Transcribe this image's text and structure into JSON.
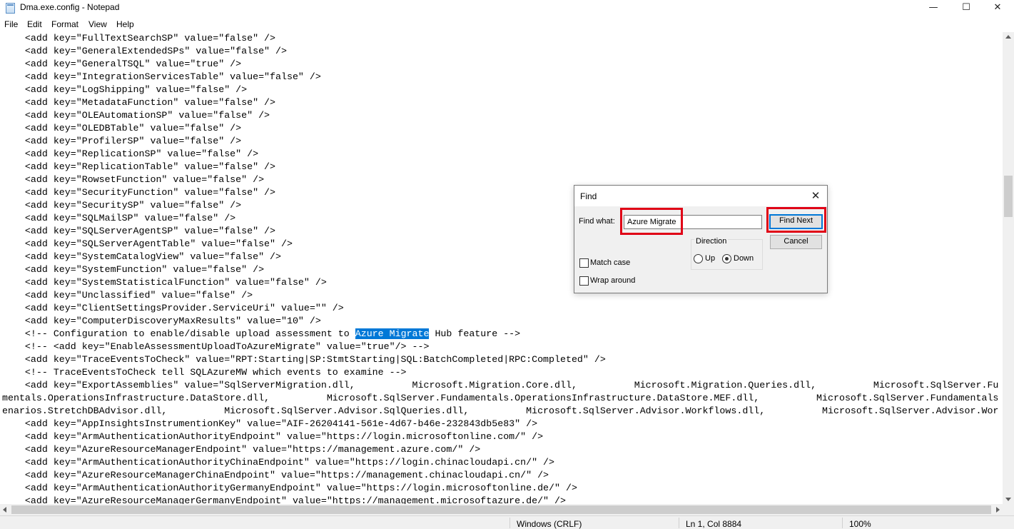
{
  "window": {
    "title": "Dma.exe.config - Notepad",
    "minimize_glyph": "—",
    "maximize_glyph": "☐",
    "close_glyph": "✕",
    "app_icon": "notepad-icon"
  },
  "menu": [
    "File",
    "Edit",
    "Format",
    "View",
    "Help"
  ],
  "editor": {
    "lines": [
      "    <add key=\"FullTextSearchSP\" value=\"false\" />",
      "    <add key=\"GeneralExtendedSPs\" value=\"false\" />",
      "    <add key=\"GeneralTSQL\" value=\"true\" />",
      "    <add key=\"IntegrationServicesTable\" value=\"false\" />",
      "    <add key=\"LogShipping\" value=\"false\" />",
      "    <add key=\"MetadataFunction\" value=\"false\" />",
      "    <add key=\"OLEAutomationSP\" value=\"false\" />",
      "    <add key=\"OLEDBTable\" value=\"false\" />",
      "    <add key=\"ProfilerSP\" value=\"false\" />",
      "    <add key=\"ReplicationSP\" value=\"false\" />",
      "    <add key=\"ReplicationTable\" value=\"false\" />",
      "    <add key=\"RowsetFunction\" value=\"false\" />",
      "    <add key=\"SecurityFunction\" value=\"false\" />",
      "    <add key=\"SecuritySP\" value=\"false\" />",
      "    <add key=\"SQLMailSP\" value=\"false\" />",
      "    <add key=\"SQLServerAgentSP\" value=\"false\" />",
      "    <add key=\"SQLServerAgentTable\" value=\"false\" />",
      "    <add key=\"SystemCatalogView\" value=\"false\" />",
      "    <add key=\"SystemFunction\" value=\"false\" />",
      "    <add key=\"SystemStatisticalFunction\" value=\"false\" />",
      "    <add key=\"Unclassified\" value=\"false\" />",
      "    <add key=\"ClientSettingsProvider.ServiceUri\" value=\"\" />",
      "    <add key=\"ComputerDiscoveryMaxResults\" value=\"10\" />"
    ],
    "highlight_line": {
      "before": "    <!-- Configuration to enable/disable upload assessment to ",
      "selected": "Azure Migrate",
      "after": " Hub feature -->"
    },
    "lines_after": [
      "    <!-- <add key=\"EnableAssessmentUploadToAzureMigrate\" value=\"true\"/> -->",
      "    <add key=\"TraceEventsToCheck\" value=\"RPT:Starting|SP:StmtStarting|SQL:BatchCompleted|RPC:Completed\" />",
      "    <!-- TraceEventsToCheck tell SQLAzureMW which events to examine -->",
      "    <add key=\"ExportAssemblies\" value=\"SqlServerMigration.dll,          Microsoft.Migration.Core.dll,          Microsoft.Migration.Queries.dll,          Microsoft.SqlServer.Fu",
      "mentals.OperationsInfrastructure.DataStore.dll,          Microsoft.SqlServer.Fundamentals.OperationsInfrastructure.DataStore.MEF.dll,          Microsoft.SqlServer.Fundamentals",
      "enarios.StretchDBAdvisor.dll,          Microsoft.SqlServer.Advisor.SqlQueries.dll,          Microsoft.SqlServer.Advisor.Workflows.dll,          Microsoft.SqlServer.Advisor.Wor",
      "    <add key=\"AppInsightsInstrumentionKey\" value=\"AIF-26204141-561e-4d67-b46e-232843db5e83\" />",
      "    <add key=\"ArmAuthenticationAuthorityEndpoint\" value=\"https://login.microsoftonline.com/\" />",
      "    <add key=\"AzureResourceManagerEndpoint\" value=\"https://management.azure.com/\" />",
      "    <add key=\"ArmAuthenticationAuthorityChinaEndpoint\" value=\"https://login.chinacloudapi.cn/\" />",
      "    <add key=\"AzureResourceManagerChinaEndpoint\" value=\"https://management.chinacloudapi.cn/\" />",
      "    <add key=\"ArmAuthenticationAuthorityGermanyEndpoint\" value=\"https://login.microsoftonline.de/\" />",
      "    <add key=\"AzureResourceManagerGermanyEndpoint\" value=\"https://management.microsoftazure.de/\" />"
    ]
  },
  "status": {
    "line_ending": "Windows (CRLF)",
    "position": "Ln 1, Col 8884",
    "zoom": "100%"
  },
  "find_dialog": {
    "title": "Find",
    "find_what_label": "Find what:",
    "find_what_value": "Azure Migrate",
    "find_next_label": "Find Next",
    "cancel_label": "Cancel",
    "direction_label": "Direction",
    "up_label": "Up",
    "down_label": "Down",
    "direction_selected": "Down",
    "match_case_label": "Match case",
    "match_case_checked": false,
    "wrap_around_label": "Wrap around",
    "wrap_around_checked": false,
    "annotation_color": "#e00016"
  }
}
